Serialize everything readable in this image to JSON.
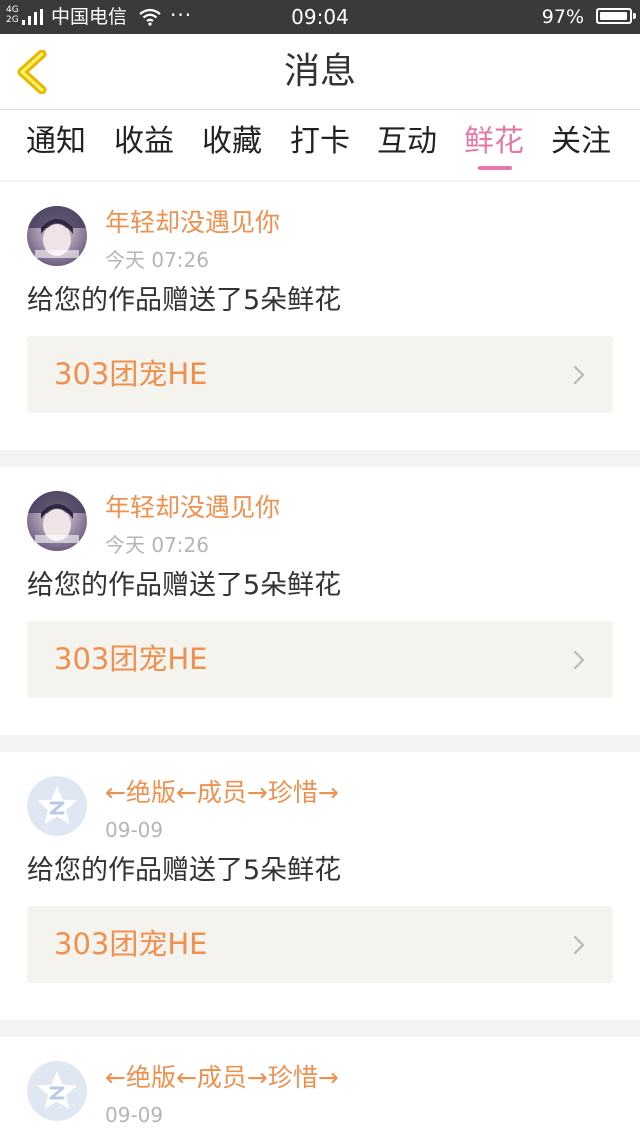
{
  "status_bar": {
    "network": [
      "4G",
      "2G"
    ],
    "carrier": "中国电信",
    "more": "···",
    "time": "09:04",
    "battery_percent": "97%",
    "battery_level": 0.97
  },
  "header": {
    "title": "消息"
  },
  "tabs": [
    {
      "label": "通知",
      "active": false
    },
    {
      "label": "收益",
      "active": false
    },
    {
      "label": "收藏",
      "active": false
    },
    {
      "label": "打卡",
      "active": false
    },
    {
      "label": "互动",
      "active": false
    },
    {
      "label": "鲜花",
      "active": true
    },
    {
      "label": "关注",
      "active": false
    }
  ],
  "messages": [
    {
      "user": "年轻却没遇见你",
      "time": "今天 07:26",
      "text": "给您的作品赠送了5朵鲜花",
      "work": "303团宠HE",
      "avatar": "photo"
    },
    {
      "user": "年轻却没遇见你",
      "time": "今天 07:26",
      "text": "给您的作品赠送了5朵鲜花",
      "work": "303团宠HE",
      "avatar": "photo"
    },
    {
      "user": "←绝版←成员→珍惜→",
      "time": "09-09",
      "text": "给您的作品赠送了5朵鲜花",
      "work": "303团宠HE",
      "avatar": "default"
    },
    {
      "user": "←绝版←成员→珍惜→",
      "time": "09-09",
      "text": "",
      "work": "",
      "avatar": "default"
    }
  ],
  "colors": {
    "accent_orange": "#f0904e",
    "active_tab": "#e678a8",
    "status_bar_bg": "#3a3a3a",
    "back_arrow": "#f2c200",
    "page_bg": "#f3f3f3"
  }
}
